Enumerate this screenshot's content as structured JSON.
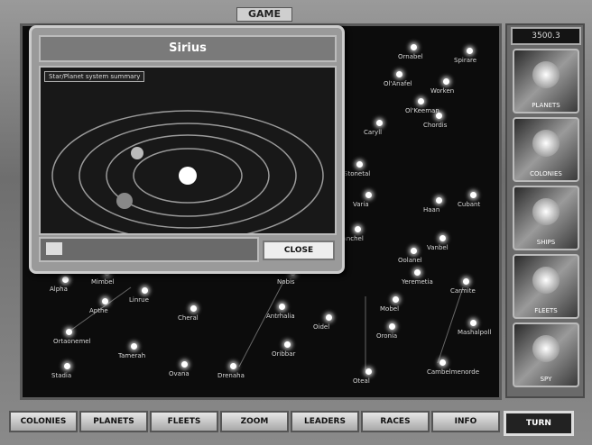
{
  "title": "GAME",
  "sidebar": {
    "stardate": "3500.3",
    "buttons": [
      {
        "label": "PLANETS",
        "name": "planets-button"
      },
      {
        "label": "COLONIES",
        "name": "colonies-button"
      },
      {
        "label": "SHIPS",
        "name": "ships-button"
      },
      {
        "label": "FLEETS",
        "name": "fleets-button"
      },
      {
        "label": "SPY",
        "name": "spy-button"
      }
    ]
  },
  "popup": {
    "title": "Sirius",
    "note": "Star/Planet system summary",
    "close": "CLOSE"
  },
  "stars": [
    {
      "name": "Ornabel"
    },
    {
      "name": "Spirare"
    },
    {
      "name": "Ol'Anafel"
    },
    {
      "name": "Worken"
    },
    {
      "name": "Ol'Keeman"
    },
    {
      "name": "Caryll"
    },
    {
      "name": "Chordis"
    },
    {
      "name": "Stonetal"
    },
    {
      "name": "Varia"
    },
    {
      "name": "Haan"
    },
    {
      "name": "Cubant"
    },
    {
      "name": "Anchel"
    },
    {
      "name": "Vanbel"
    },
    {
      "name": "Alpha"
    },
    {
      "name": "Mimbel"
    },
    {
      "name": "Yeremetia"
    },
    {
      "name": "Carmite"
    },
    {
      "name": "Nobis"
    },
    {
      "name": "Apthe"
    },
    {
      "name": "Linrue"
    },
    {
      "name": "Cheral"
    },
    {
      "name": "Antrhalia"
    },
    {
      "name": "Oidel"
    },
    {
      "name": "Oronia"
    },
    {
      "name": "Ortaonemel"
    },
    {
      "name": "Tamerah"
    },
    {
      "name": "Mashalpoll"
    },
    {
      "name": "Oribbar"
    },
    {
      "name": "Stadia"
    },
    {
      "name": "Ovana"
    },
    {
      "name": "Drenaha"
    },
    {
      "name": "Oteal"
    },
    {
      "name": "Cambelmenorde"
    },
    {
      "name": "Oolanel"
    },
    {
      "name": "Mobel"
    }
  ],
  "tabs": [
    {
      "label": "COLONIES"
    },
    {
      "label": "PLANETS"
    },
    {
      "label": "FLEETS"
    },
    {
      "label": "ZOOM"
    },
    {
      "label": "LEADERS"
    },
    {
      "label": "RACES"
    },
    {
      "label": "INFO"
    }
  ],
  "turn": "TURN"
}
